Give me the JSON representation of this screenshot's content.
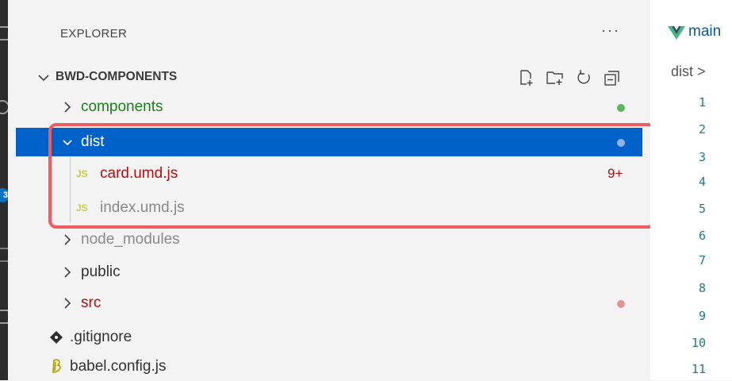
{
  "explorer": {
    "title": "EXPLORER",
    "more_label": "···",
    "section_title": "BWD-COMPONENTS",
    "actions": [
      "new-file-icon",
      "new-folder-icon",
      "refresh-icon",
      "collapse-all-icon"
    ]
  },
  "activity_bar": {
    "badge": "3"
  },
  "tree": {
    "components": {
      "label": "components",
      "color": "#1e7d1e",
      "status_dot": "#5bb85b"
    },
    "dist": {
      "label": "dist",
      "color": "#ffffff",
      "status_dot": "#8fb3e8"
    },
    "card": {
      "icon": "JS",
      "label": "card.umd.js",
      "color": "#b01011",
      "badge": "9+"
    },
    "index": {
      "icon": "JS",
      "label": "index.umd.js",
      "color": "#8a8a8a"
    },
    "node_modules": {
      "label": "node_modules",
      "color": "#8a8a8a"
    },
    "public": {
      "label": "public",
      "color": "#333333"
    },
    "src": {
      "label": "src",
      "color": "#b01011",
      "status_dot": "#e09494"
    },
    "gitignore": {
      "label": ".gitignore",
      "icon": "git-icon"
    },
    "babel": {
      "label": "babel.config.js",
      "icon": "babel-icon"
    }
  },
  "editor": {
    "tab_label": "main",
    "breadcrumb": "dist >",
    "line_numbers": [
      "1",
      "2",
      "3",
      "4",
      "5",
      "6",
      "7",
      "8",
      "9",
      "10",
      "11"
    ]
  }
}
